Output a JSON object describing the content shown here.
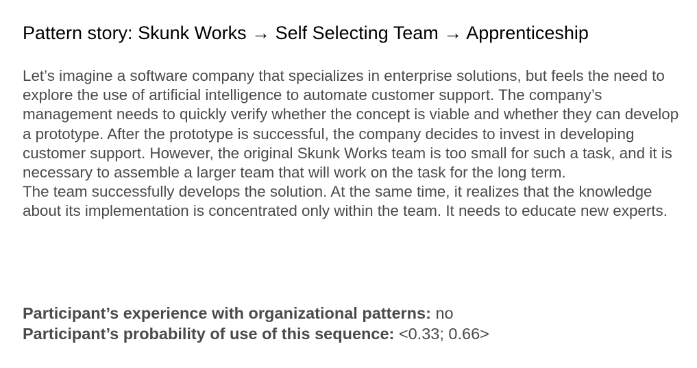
{
  "title": "Pattern story: Skunk Works → Self Selecting Team → Apprenticeship",
  "story": {
    "paragraph_1": "Let’s imagine a software company that specializes in enterprise solutions, but feels the need to explore the use of artificial intelligence to automate customer support. The company’s management needs to quickly verify whether the concept is viable and whether they can develop a prototype. After the prototype is successful, the company decides to invest in developing customer support. However, the original Skunk Works team is too small for such a task, and it is necessary to assemble a larger team that will work on the task for the long term.",
    "paragraph_2": "The team successfully develops the solution. At the same time, it realizes that the knowledge about its implementation is concentrated only within the team. It needs to educate new experts."
  },
  "participant": {
    "experience_label": "Participant’s experience with organizational patterns:",
    "experience_value": "no",
    "probability_label": "Participant’s probability of use of this sequence:",
    "probability_value": "<0.33; 0.66>"
  }
}
